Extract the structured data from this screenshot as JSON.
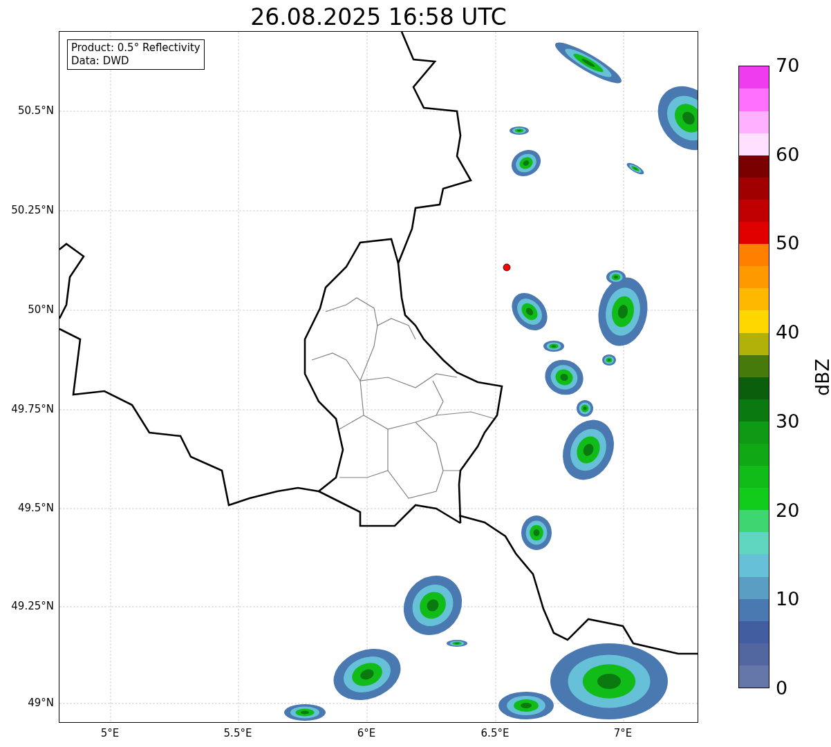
{
  "title": "26.08.2025 16:58 UTC",
  "info_box": [
    "Product: 0.5° Reflectivity",
    "Data: DWD"
  ],
  "x_ticks": [
    "5°E",
    "5.5°E",
    "6°E",
    "6.5°E",
    "7°E"
  ],
  "y_ticks": [
    "50.5°N",
    "50.25°N",
    "50°N",
    "49.75°N",
    "49.5°N",
    "49.25°N",
    "49°N"
  ],
  "colorbar": {
    "label": "dBZ",
    "ticks": [
      "70",
      "60",
      "50",
      "40",
      "30",
      "20",
      "10",
      "0"
    ],
    "bands": [
      {
        "color": "#6577a8"
      },
      {
        "color": "#5266a0"
      },
      {
        "color": "#435ea0"
      },
      {
        "color": "#4a78b0"
      },
      {
        "color": "#5b9ec4"
      },
      {
        "color": "#66c0d8"
      },
      {
        "color": "#60d6c0"
      },
      {
        "color": "#3ed670"
      },
      {
        "color": "#11cc1a"
      },
      {
        "color": "#11bb18"
      },
      {
        "color": "#10a915"
      },
      {
        "color": "#0e9a14"
      },
      {
        "color": "#0a7a10"
      },
      {
        "color": "#0b5e0b"
      },
      {
        "color": "#467a0a"
      },
      {
        "color": "#b0b20a"
      },
      {
        "color": "#ffd700"
      },
      {
        "color": "#ffb800"
      },
      {
        "color": "#ff9900"
      },
      {
        "color": "#ff7f00"
      },
      {
        "color": "#e00000"
      },
      {
        "color": "#c00000"
      },
      {
        "color": "#a00000"
      },
      {
        "color": "#7a0000"
      },
      {
        "color": "#ffe0ff"
      },
      {
        "color": "#ffb0ff"
      },
      {
        "color": "#ff70ff"
      },
      {
        "color": "#ee3cee"
      }
    ]
  }
}
